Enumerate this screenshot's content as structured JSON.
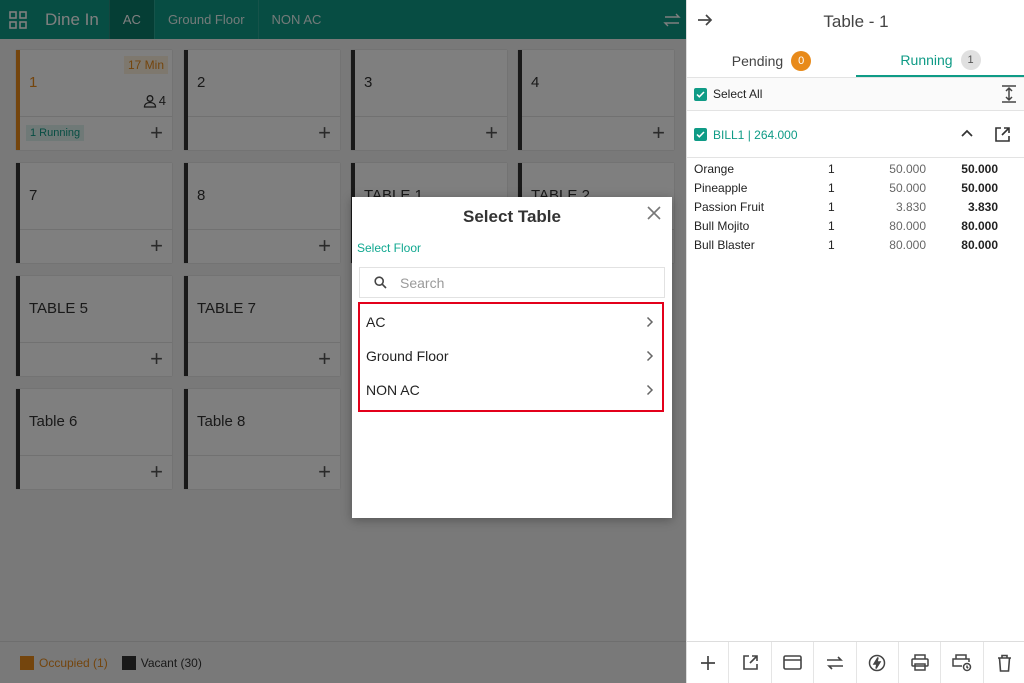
{
  "topbar": {
    "title": "Dine In",
    "tabs": [
      {
        "label": "AC"
      },
      {
        "label": "Ground Floor"
      },
      {
        "label": "NON AC"
      }
    ]
  },
  "tables": [
    {
      "name": "1",
      "status": "occupied",
      "timer": "17 Min",
      "guests": "4",
      "badge": "1 Running"
    },
    {
      "name": "2"
    },
    {
      "name": "3"
    },
    {
      "name": "4"
    },
    {
      "name": "7"
    },
    {
      "name": "8"
    },
    {
      "name": "TABLE 1"
    },
    {
      "name": "TABLE 2"
    },
    {
      "name": "TABLE 5"
    },
    {
      "name": "TABLE 7"
    },
    {
      "name": "Table 6"
    },
    {
      "name": "Table 8"
    }
  ],
  "legend": {
    "occupied": "Occupied (1)",
    "vacant": "Vacant (30)"
  },
  "modal": {
    "title": "Select Table",
    "floor_label": "Select Floor",
    "search_placeholder": "Search",
    "floors": [
      "AC",
      "Ground Floor",
      "NON AC"
    ]
  },
  "panel": {
    "title": "Table - 1",
    "tabs": [
      {
        "label": "Pending",
        "count": "0"
      },
      {
        "label": "Running",
        "count": "1"
      }
    ],
    "select_all": "Select All",
    "bill_label": "BILL1 | 264.000",
    "items": [
      {
        "name": "Orange",
        "qty": "1",
        "price": "50.000",
        "total": "50.000"
      },
      {
        "name": "Pineapple",
        "qty": "1",
        "price": "50.000",
        "total": "50.000"
      },
      {
        "name": "Passion Fruit",
        "qty": "1",
        "price": "3.830",
        "total": "3.830"
      },
      {
        "name": "Bull Mojito",
        "qty": "1",
        "price": "80.000",
        "total": "80.000"
      },
      {
        "name": "Bull Blaster",
        "qty": "1",
        "price": "80.000",
        "total": "80.000"
      }
    ],
    "toolbar_icons": [
      "plus-icon",
      "open-external-icon",
      "card-icon",
      "transfer-icon",
      "flash-icon",
      "print-icon",
      "print-settings-icon",
      "delete-icon"
    ]
  },
  "colors": {
    "accent": "#0f9b86",
    "occupied": "#e88a1a",
    "vacant": "#333333",
    "highlight": "#e3001b"
  }
}
